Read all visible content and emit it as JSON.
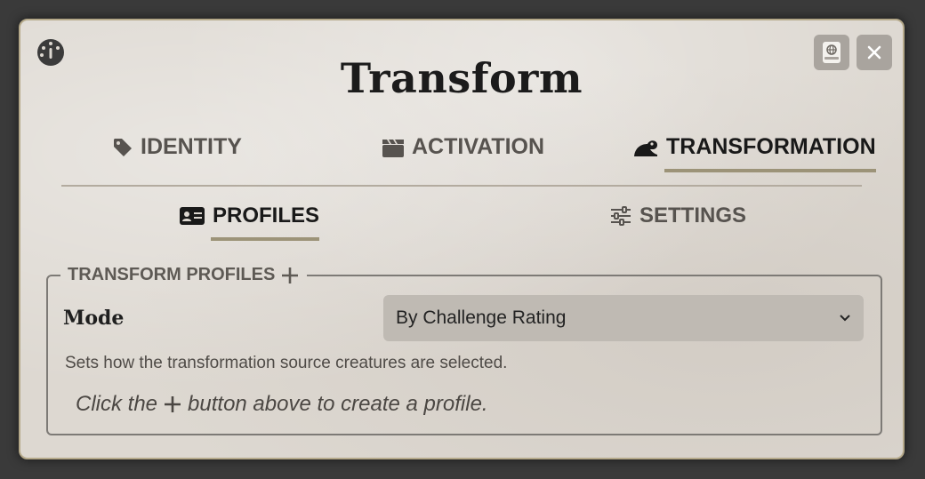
{
  "dialog": {
    "title": "Transform"
  },
  "tabs": [
    {
      "label": "IDENTITY",
      "icon": "tag-icon"
    },
    {
      "label": "ACTIVATION",
      "icon": "clapperboard-icon"
    },
    {
      "label": "TRANSFORMATION",
      "icon": "frog-icon",
      "active": true
    }
  ],
  "subtabs": [
    {
      "label": "PROFILES",
      "icon": "id-card-icon",
      "active": true
    },
    {
      "label": "SETTINGS",
      "icon": "sliders-icon"
    }
  ],
  "profiles": {
    "legend": "TRANSFORM PROFILES",
    "mode_label": "Mode",
    "mode_value": "By Challenge Rating",
    "mode_hint": "Sets how the transformation source creatures are selected.",
    "empty_prefix": "Click the",
    "empty_suffix": "button above to create a profile."
  },
  "colors": {
    "accent_underline": "#9c9378",
    "sheet_border": "#b5a98a"
  }
}
